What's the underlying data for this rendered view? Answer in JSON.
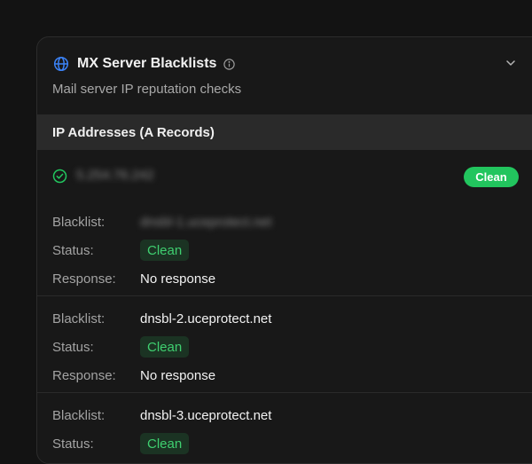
{
  "card": {
    "title": "MX Server Blacklists",
    "subtitle": "Mail server IP reputation checks",
    "section_title": "IP Addresses (A Records)"
  },
  "ip": {
    "address": "5.254.76.242",
    "status": "Clean"
  },
  "labels": {
    "blacklist": "Blacklist:",
    "status": "Status:",
    "response": "Response:"
  },
  "entries": [
    {
      "blacklist": "dnsbl-1.uceprotect.net",
      "status": "Clean",
      "response": "No response"
    },
    {
      "blacklist": "dnsbl-2.uceprotect.net",
      "status": "Clean",
      "response": "No response"
    },
    {
      "blacklist": "dnsbl-3.uceprotect.net",
      "status": "Clean",
      "response": ""
    }
  ],
  "colors": {
    "accent_blue": "#3b82f6",
    "clean_green": "#22c55e",
    "badge_text_green": "#3fd070"
  },
  "icons": [
    "globe-icon",
    "info-icon",
    "chevron-down-icon",
    "check-circle-icon"
  ]
}
